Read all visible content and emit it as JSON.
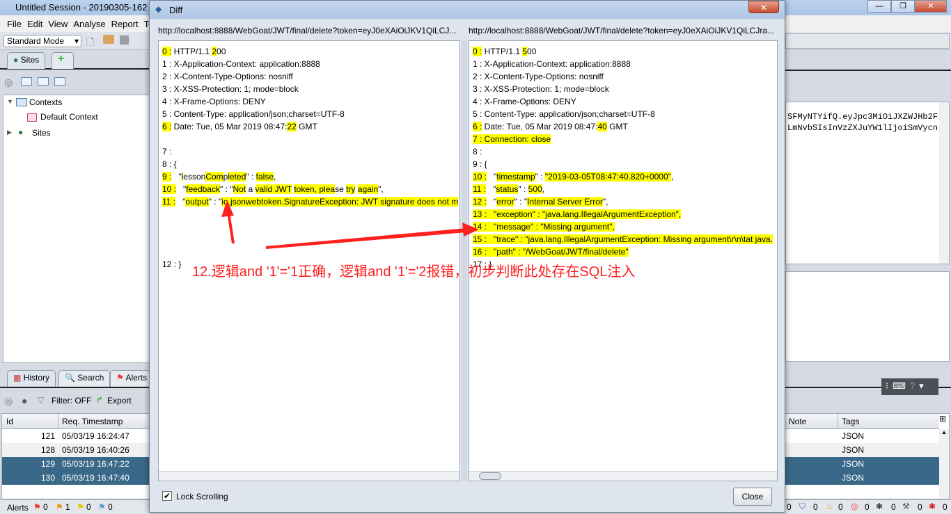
{
  "app": {
    "title": "Untitled Session - 20190305-162",
    "menu": [
      "File",
      "Edit",
      "View",
      "Analyse",
      "Report",
      "To"
    ],
    "mode": "Standard Mode",
    "tabs": {
      "sites": "Sites"
    },
    "tree": {
      "contexts": "Contexts",
      "default_context": "Default Context",
      "sites": "Sites"
    },
    "request_text": [
      "SFMyNTYifQ.eyJpc3MiOiJXZWJHb2F",
      "LmNvbSIsInVzZXJuYW1lIjoiSmVycn"
    ],
    "bottom_tabs": [
      "History",
      "Search",
      "Alerts"
    ],
    "filter": "Filter: OFF",
    "export": "Export",
    "table": {
      "headers": [
        "Id",
        "Req. Timestamp",
        "Note",
        "Tags"
      ],
      "rows": [
        {
          "id": "121",
          "ts": "05/03/19 16:24:47",
          "tags": "JSON",
          "selected": false
        },
        {
          "id": "128",
          "ts": "05/03/19 16:40:26",
          "tags": "JSON",
          "selected": false
        },
        {
          "id": "129",
          "ts": "05/03/19 16:47:22",
          "tags": "JSON",
          "selected": true
        },
        {
          "id": "130",
          "ts": "05/03/19 16:47:40",
          "tags": "JSON",
          "selected": true
        }
      ]
    },
    "status": {
      "alerts_label": "Alerts",
      "flags": [
        "0",
        "1",
        "0",
        "0"
      ],
      "right_counts": [
        "0",
        "0",
        "0",
        "0",
        "0",
        "0",
        "0"
      ]
    }
  },
  "diff": {
    "title": "Diff",
    "left": {
      "url": "http://localhost:8888/WebGoat/JWT/final/delete?token=eyJ0eXAiOiJKV1QiLCJ...",
      "lines": [
        [
          [
            "0 :",
            1
          ],
          [
            " HTTP/1.1 ",
            0
          ],
          [
            "2",
            1
          ],
          [
            "00",
            0
          ]
        ],
        [
          [
            "1 : X-Application-Context: application:8888",
            0
          ]
        ],
        [
          [
            "2 : X-Content-Type-Options: nosniff",
            0
          ]
        ],
        [
          [
            "3 : X-XSS-Protection: 1; mode=block",
            0
          ]
        ],
        [
          [
            "4 : X-Frame-Options: DENY",
            0
          ]
        ],
        [
          [
            "5 : Content-Type: application/json;charset=UTF-8",
            0
          ]
        ],
        [
          [
            "6 :",
            1
          ],
          [
            " Date: Tue, 05 Mar 2019 08:47:",
            0
          ],
          [
            "22",
            1
          ],
          [
            " GMT",
            0
          ]
        ],
        [],
        [
          [
            "7 :",
            0
          ]
        ],
        [
          [
            "8 : {",
            0
          ]
        ],
        [
          [
            "9 :",
            1
          ],
          [
            "   \"",
            0
          ],
          [
            "l",
            1
          ],
          [
            "esson",
            0
          ],
          [
            "Com",
            1
          ],
          [
            "p",
            0
          ],
          [
            "leted",
            1
          ],
          [
            "\" : ",
            0
          ],
          [
            "false",
            1
          ],
          [
            ",",
            0
          ]
        ],
        [
          [
            "10 :",
            1
          ],
          [
            "   \"",
            0
          ],
          [
            "feedback",
            1
          ],
          [
            "\" : \"",
            0
          ],
          [
            "Not",
            1
          ],
          [
            " a ",
            0
          ],
          [
            "valid JWT",
            1
          ],
          [
            " ",
            0
          ],
          [
            "token, plea",
            1
          ],
          [
            "se ",
            0
          ],
          [
            "try",
            1
          ],
          [
            " ",
            0
          ],
          [
            "again",
            1
          ],
          [
            "\",",
            0
          ]
        ],
        [
          [
            "11 :",
            1
          ],
          [
            "   \"",
            0
          ],
          [
            "output",
            1
          ],
          [
            "\" : \"",
            0
          ],
          [
            "io.jsonwebtoken.SignatureException: JWT signature does not m",
            1
          ]
        ],
        [],
        [],
        [],
        [],
        [
          [
            "12 : }",
            0
          ]
        ]
      ]
    },
    "right": {
      "url": "http://localhost:8888/WebGoat/JWT/final/delete?token=eyJ0eXAiOiJKV1QiLCJra...",
      "lines": [
        [
          [
            "0 :",
            1
          ],
          [
            " HTTP/1.1 ",
            0
          ],
          [
            "5",
            1
          ],
          [
            "00",
            0
          ]
        ],
        [
          [
            "1 : X-Application-Context: application:8888",
            0
          ]
        ],
        [
          [
            "2 : X-Content-Type-Options: nosniff",
            0
          ]
        ],
        [
          [
            "3 : X-XSS-Protection: 1; mode=block",
            0
          ]
        ],
        [
          [
            "4 : X-Frame-Options: DENY",
            0
          ]
        ],
        [
          [
            "5 : Content-Type: application/json;charset=UTF-8",
            0
          ]
        ],
        [
          [
            "6 :",
            1
          ],
          [
            " Date: Tue, 05 Mar 2019 08:47:",
            0
          ],
          [
            "40",
            1
          ],
          [
            " GMT",
            0
          ]
        ],
        [
          [
            "7 : Connection: close",
            1
          ]
        ],
        [
          [
            "8 :",
            0
          ]
        ],
        [
          [
            "9 : {",
            0
          ]
        ],
        [
          [
            "10 :",
            1
          ],
          [
            "   \"",
            0
          ],
          [
            "timestamp",
            1
          ],
          [
            "\" : ",
            0
          ],
          [
            "\"2019-03-05T08:47:40.820+0000\"",
            1
          ],
          [
            ",",
            0
          ]
        ],
        [
          [
            "11 :",
            1
          ],
          [
            "   \"",
            0
          ],
          [
            "status",
            1
          ],
          [
            "\" : ",
            0
          ],
          [
            "500",
            1
          ],
          [
            ",",
            0
          ]
        ],
        [
          [
            "12 :",
            1
          ],
          [
            "   \"",
            0
          ],
          [
            "error",
            1
          ],
          [
            "\" : \"",
            0
          ],
          [
            "Internal Server Error",
            1
          ],
          [
            "\",",
            0
          ]
        ],
        [
          [
            "13 :   \"exception\" : \"java.lang.IllegalArgumentException\",",
            1
          ]
        ],
        [
          [
            "14 :   \"message\" : \"Missing argument\",",
            1
          ]
        ],
        [
          [
            "15 :   \"trace\" : \"java.lang.IllegalArgumentException: Missing argument\\r\\n\\tat java.",
            1
          ]
        ],
        [
          [
            "16 :   \"path\" : \"/WebGoat/JWT/final/delete\"",
            1
          ]
        ],
        [
          [
            "17 : }",
            0
          ]
        ]
      ]
    },
    "lock_scrolling": {
      "label": "Lock Scrolling",
      "checked": true
    },
    "close": "Close"
  },
  "annotation": "12.逻辑and '1'='1正确，逻辑and '1'='2报错，初步判断此处存在SQL注入",
  "colors": {
    "highlight": "#ffff00",
    "selection": "#3a6889",
    "annotation": "#ff2020"
  }
}
